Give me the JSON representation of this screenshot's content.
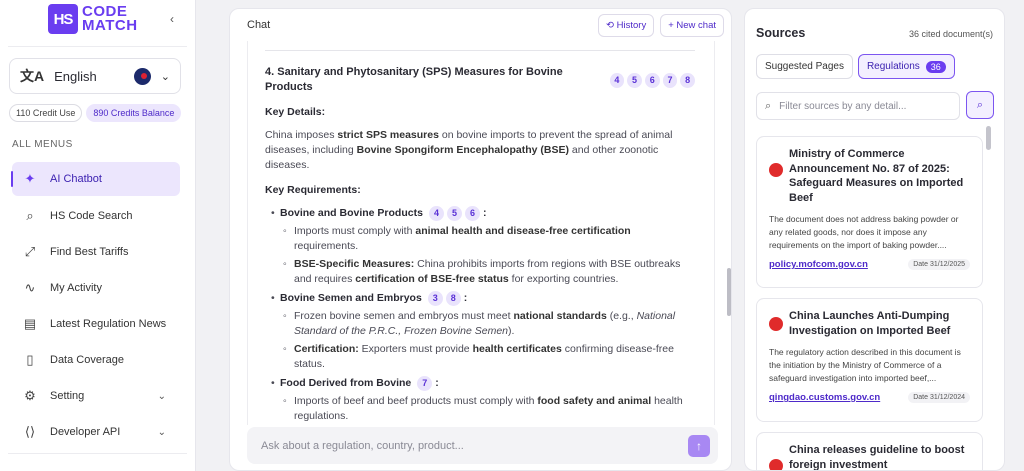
{
  "brand": {
    "mark": "HS",
    "line1": "CODE",
    "line2": "MATCH"
  },
  "language": {
    "label": "English"
  },
  "credits": {
    "used": "110 Credit Use",
    "balance": "890 Credits Balance"
  },
  "menus": {
    "title": "ALL MENUS",
    "items": [
      {
        "label": "AI Chatbot",
        "icon": "sparkle-icon"
      },
      {
        "label": "HS Code Search",
        "icon": "search-icon"
      },
      {
        "label": "Find Best Tariffs",
        "icon": "trend-icon"
      },
      {
        "label": "My Activity",
        "icon": "activity-icon"
      },
      {
        "label": "Latest Regulation News",
        "icon": "news-icon"
      },
      {
        "label": "Data Coverage",
        "icon": "document-icon"
      },
      {
        "label": "Setting",
        "icon": "gear-icon"
      },
      {
        "label": "Developer API",
        "icon": "code-icon"
      }
    ]
  },
  "chat": {
    "title": "Chat",
    "history_label": "History",
    "new_chat_label": "New chat",
    "input_placeholder": "Ask about a regulation, country, product...",
    "message": {
      "heading": "4. Sanitary and Phytosanitary (SPS) Measures for Bovine Products",
      "heading_refs": [
        "4",
        "5",
        "6",
        "7",
        "8"
      ],
      "key_details_label": "Key Details:",
      "details_p1": "China imposes ",
      "details_b1": "strict SPS measures",
      "details_p2": " on bovine imports to prevent the spread of animal diseases, including ",
      "details_b2": "Bovine Spongiform Encephalopathy (BSE)",
      "details_p3": " and other zoonotic diseases.",
      "key_req_label": "Key Requirements:",
      "groups": [
        {
          "title": "Bovine and Bovine Products",
          "refs": [
            "4",
            "5",
            "6"
          ],
          "colon": ":",
          "sub": [
            {
              "a": "Imports must comply with ",
              "b": "animal health and disease-free certification",
              "c": " requirements."
            },
            {
              "b0": "BSE-Specific Measures:",
              "a": " China prohibits imports from regions with BSE outbreaks and requires ",
              "b": "certification of BSE-free status",
              "c": " for exporting countries."
            }
          ]
        },
        {
          "title": "Bovine Semen and Embryos",
          "refs": [
            "3",
            "8"
          ],
          "colon": ":",
          "sub": [
            {
              "a": "Frozen bovine semen and embryos must meet ",
              "b": "national standards",
              "c": " (e.g., ",
              "i": "National Standard of the P.R.C., Frozen Bovine Semen",
              "d": ")."
            },
            {
              "b0": "Certification:",
              "a": " Exporters must provide ",
              "b": "health certificates",
              "c": " confirming disease-free status."
            }
          ]
        },
        {
          "title": "Food Derived from Bovine",
          "refs": [
            "7"
          ],
          "colon": ":",
          "sub": [
            {
              "a": "Imports of beef and beef products must comply with ",
              "b": "food safety and animal",
              "c": " health regulations."
            }
          ]
        }
      ]
    }
  },
  "sources": {
    "title": "Sources",
    "count": "36 cited document(s)",
    "tab_suggested": "Suggested Pages",
    "tab_regulations": "Regulations",
    "tab_regulations_count": "36",
    "filter_placeholder": "Filter sources by any detail...",
    "cards": [
      {
        "title": "Ministry of Commerce Announcement No. 87 of 2025: Safeguard Measures on Imported Beef",
        "desc": "The document does not address baking powder or any related goods, nor does it impose any requirements on the import of baking powder....",
        "link": "policy.mofcom.gov.cn",
        "date": "Date 31/12/2025"
      },
      {
        "title": "China Launches Anti-Dumping Investigation on Imported Beef",
        "desc": "The regulatory action described in this document is the initiation by the Ministry of Commerce of a safeguard investigation into imported beef,...",
        "link": "qingdao.customs.gov.cn",
        "date": "Date 31/12/2024"
      },
      {
        "title": "China releases guideline to boost foreign investment",
        "desc": "",
        "link": "",
        "date": ""
      }
    ]
  },
  "colors": {
    "accent": "#6a3df0",
    "accent_light": "#ece6fd",
    "status_red": "#e02b2b"
  }
}
